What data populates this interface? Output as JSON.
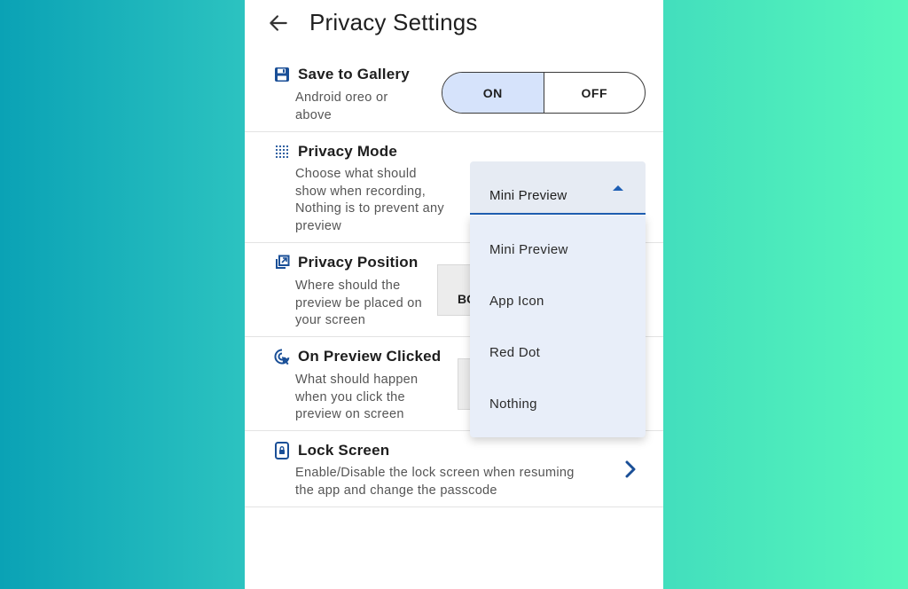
{
  "header": {
    "title": "Privacy Settings",
    "back_icon": "arrow-left-icon"
  },
  "sections": {
    "save_gallery": {
      "icon": "floppy-disk-icon",
      "title": "Save to Gallery",
      "desc_lines": [
        "Android oreo or",
        "above"
      ],
      "toggle": {
        "on_label": "ON",
        "off_label": "OFF",
        "selected": "ON"
      }
    },
    "privacy_mode": {
      "icon": "dotted-grid-icon",
      "title": "Privacy Mode",
      "desc_lines": [
        "Choose what should",
        "show when recording,",
        "Nothing is to prevent any",
        "preview"
      ],
      "dropdown": {
        "selected": "Mini Preview",
        "options": [
          "Mini Preview",
          "App Icon",
          "Red Dot",
          "Nothing"
        ]
      }
    },
    "privacy_position": {
      "icon": "picture-in-picture-icon",
      "title": "Privacy Position",
      "desc_lines": [
        "Where should the",
        "preview be placed on",
        "your screen"
      ],
      "button_partial": "BC"
    },
    "on_preview_clicked": {
      "icon": "cursor-click-icon",
      "title": "On Preview Clicked",
      "desc_lines": [
        "What should happen",
        "when you click the",
        "preview on screen"
      ]
    },
    "lock_screen": {
      "icon": "lock-phone-icon",
      "title": "Lock Screen",
      "desc_lines": [
        "Enable/Disable the lock screen when resuming",
        "the app and change the passcode"
      ],
      "chevron_icon": "chevron-right-icon"
    }
  },
  "colors": {
    "accent": "#1e5fb4",
    "toggle_on_bg": "#d6e3fb",
    "menu_bg": "#e8eef9",
    "icon_blue": "#1a4f97"
  }
}
